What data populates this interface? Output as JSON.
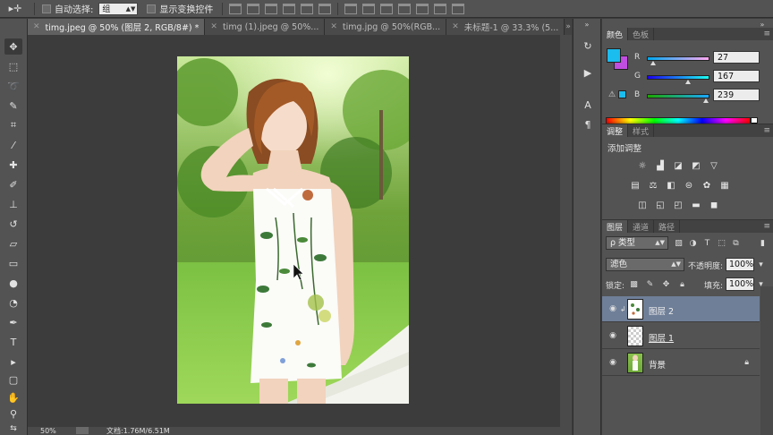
{
  "options_bar": {
    "tool_icon": "move-tool-icon",
    "auto_select_label": "自动选择:",
    "auto_select_value": "组",
    "show_transform_label": "显示变换控件"
  },
  "tabs": [
    {
      "label": "timg.jpeg @ 50% (图层 2, RGB/8#) *",
      "active": true
    },
    {
      "label": "timg (1).jpeg @ 50%...",
      "active": false
    },
    {
      "label": "timg.jpg @ 50%(RGB...",
      "active": false
    },
    {
      "label": "未标题-1 @ 33.3% (5...",
      "active": false
    }
  ],
  "tools": [
    "move-tool",
    "marquee-tool",
    "lasso-tool",
    "quick-select-tool",
    "crop-tool",
    "eyedropper-tool",
    "healing-brush-tool",
    "brush-tool",
    "clone-stamp-tool",
    "history-brush-tool",
    "eraser-tool",
    "gradient-tool",
    "blur-tool",
    "dodge-tool",
    "pen-tool",
    "type-tool",
    "path-select-tool",
    "shape-tool",
    "hand-tool",
    "zoom-tool"
  ],
  "status": {
    "zoom": "50%",
    "doc_info": "文档:1.76M/6.51M"
  },
  "color_panel": {
    "tabs": [
      "颜色",
      "色板"
    ],
    "foreground": "#1bbcee",
    "background": "#c04ee0",
    "r_label": "R",
    "g_label": "G",
    "b_label": "B",
    "r": "27",
    "g": "167",
    "b": "239",
    "r_level": 0.106,
    "g_level": 0.655,
    "b_level": 0.937
  },
  "adjustments_panel": {
    "tabs": [
      "调整",
      "样式"
    ],
    "title": "添加调整"
  },
  "layers_panel": {
    "tabs": [
      "图层",
      "通道",
      "路径"
    ],
    "filter_kind": "ρ 类型",
    "blend_mode": "滤色",
    "opacity_label": "不透明度:",
    "opacity": "100%",
    "lock_label": "锁定:",
    "fill_label": "填充:",
    "fill": "100%",
    "layers": [
      {
        "name": "图层 2",
        "selected": true
      },
      {
        "name": "图层 1",
        "selected": false
      },
      {
        "name": "背景",
        "selected": false
      }
    ]
  }
}
